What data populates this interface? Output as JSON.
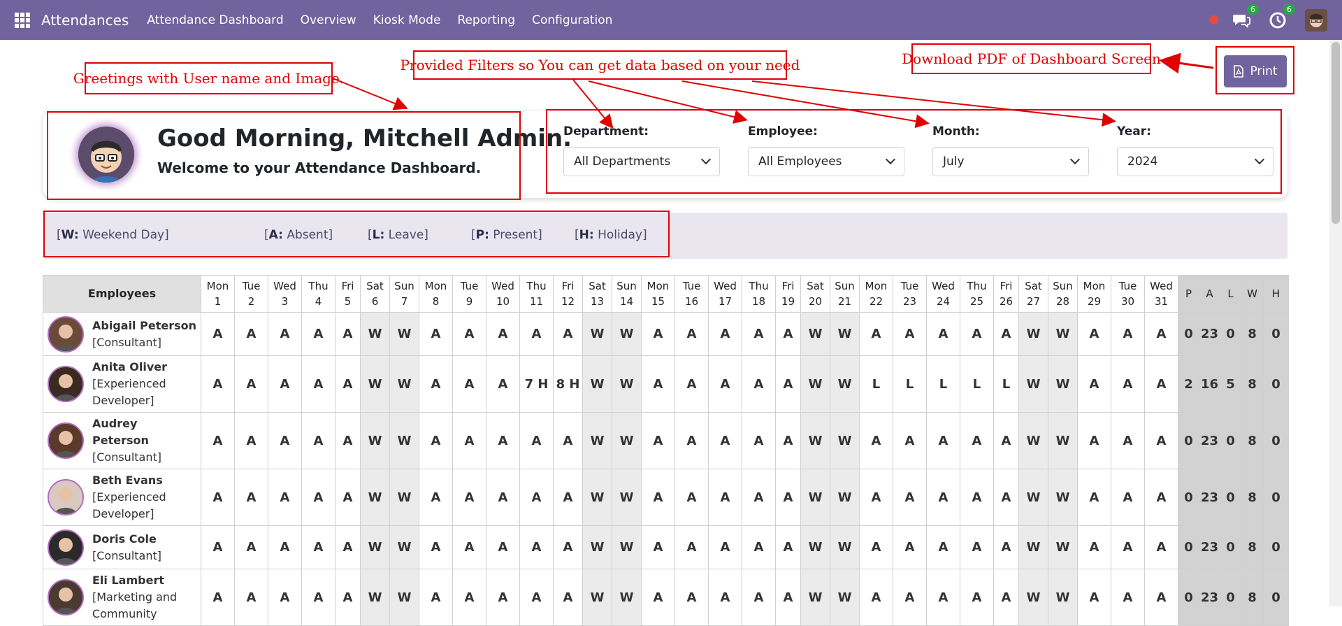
{
  "navbar": {
    "app_title": "Attendances",
    "menu": [
      "Attendance Dashboard",
      "Overview",
      "Kiosk Mode",
      "Reporting",
      "Configuration"
    ],
    "messages_badge": "6",
    "activities_badge": "6",
    "icons": [
      "apps-grid-icon",
      "record-dot-icon",
      "chat-icon",
      "clock-icon",
      "user-avatar"
    ]
  },
  "annotations": {
    "greeting_note": "Greetings with User name and Image.",
    "filters_note": "Provided Filters so You can get data based on your need",
    "pdf_note": "Download PDF of Dashboard Screen"
  },
  "print_button": {
    "label": "Print",
    "icon": "file-pdf-icon"
  },
  "greeting": {
    "title": "Good Morning, Mitchell Admin.",
    "subtitle": "Welcome to your Attendance Dashboard."
  },
  "filters": [
    {
      "label": "Department:",
      "value": "All Departments"
    },
    {
      "label": "Employee:",
      "value": "All Employees"
    },
    {
      "label": "Month:",
      "value": "July"
    },
    {
      "label": "Year:",
      "value": "2024"
    }
  ],
  "legend": [
    {
      "code": "W:",
      "text": " Weekend Day]"
    },
    {
      "code": "A:",
      "text": " Absent]"
    },
    {
      "code": "L:",
      "text": " Leave]"
    },
    {
      "code": "P:",
      "text": " Present]"
    },
    {
      "code": "H:",
      "text": " Holiday]"
    }
  ],
  "table": {
    "employee_header": "Employees",
    "days": [
      [
        "Mon",
        "1"
      ],
      [
        "Tue",
        "2"
      ],
      [
        "Wed",
        "3"
      ],
      [
        "Thu",
        "4"
      ],
      [
        "Fri",
        "5"
      ],
      [
        "Sat",
        "6"
      ],
      [
        "Sun",
        "7"
      ],
      [
        "Mon",
        "8"
      ],
      [
        "Tue",
        "9"
      ],
      [
        "Wed",
        "10"
      ],
      [
        "Thu",
        "11"
      ],
      [
        "Fri",
        "12"
      ],
      [
        "Sat",
        "13"
      ],
      [
        "Sun",
        "14"
      ],
      [
        "Mon",
        "15"
      ],
      [
        "Tue",
        "16"
      ],
      [
        "Wed",
        "17"
      ],
      [
        "Thu",
        "18"
      ],
      [
        "Fri",
        "19"
      ],
      [
        "Sat",
        "20"
      ],
      [
        "Sun",
        "21"
      ],
      [
        "Mon",
        "22"
      ],
      [
        "Tue",
        "23"
      ],
      [
        "Wed",
        "24"
      ],
      [
        "Thu",
        "25"
      ],
      [
        "Fri",
        "26"
      ],
      [
        "Sat",
        "27"
      ],
      [
        "Sun",
        "28"
      ],
      [
        "Mon",
        "29"
      ],
      [
        "Tue",
        "30"
      ],
      [
        "Wed",
        "31"
      ]
    ],
    "summary_headers": [
      "P",
      "A",
      "L",
      "W",
      "H"
    ],
    "rows": [
      {
        "name": "Abigail Peterson",
        "job": "[Consultant]",
        "marks": [
          "A",
          "A",
          "A",
          "A",
          "A",
          "W",
          "W",
          "A",
          "A",
          "A",
          "A",
          "A",
          "W",
          "W",
          "A",
          "A",
          "A",
          "A",
          "A",
          "W",
          "W",
          "A",
          "A",
          "A",
          "A",
          "A",
          "W",
          "W",
          "A",
          "A",
          "A"
        ],
        "summary": [
          "0",
          "23",
          "0",
          "8",
          "0"
        ]
      },
      {
        "name": "Anita Oliver",
        "job": "[Experienced Developer]",
        "marks": [
          "A",
          "A",
          "A",
          "A",
          "A",
          "W",
          "W",
          "A",
          "A",
          "A",
          "7 H",
          "8 H",
          "W",
          "W",
          "A",
          "A",
          "A",
          "A",
          "A",
          "W",
          "W",
          "L",
          "L",
          "L",
          "L",
          "L",
          "W",
          "W",
          "A",
          "A",
          "A"
        ],
        "summary": [
          "2",
          "16",
          "5",
          "8",
          "0"
        ]
      },
      {
        "name": "Audrey Peterson",
        "job": "[Consultant]",
        "marks": [
          "A",
          "A",
          "A",
          "A",
          "A",
          "W",
          "W",
          "A",
          "A",
          "A",
          "A",
          "A",
          "W",
          "W",
          "A",
          "A",
          "A",
          "A",
          "A",
          "W",
          "W",
          "A",
          "A",
          "A",
          "A",
          "A",
          "W",
          "W",
          "A",
          "A",
          "A"
        ],
        "summary": [
          "0",
          "23",
          "0",
          "8",
          "0"
        ]
      },
      {
        "name": "Beth Evans",
        "job": "[Experienced Developer]",
        "marks": [
          "A",
          "A",
          "A",
          "A",
          "A",
          "W",
          "W",
          "A",
          "A",
          "A",
          "A",
          "A",
          "W",
          "W",
          "A",
          "A",
          "A",
          "A",
          "A",
          "W",
          "W",
          "A",
          "A",
          "A",
          "A",
          "A",
          "W",
          "W",
          "A",
          "A",
          "A"
        ],
        "summary": [
          "0",
          "23",
          "0",
          "8",
          "0"
        ]
      },
      {
        "name": "Doris Cole",
        "job": "[Consultant]",
        "marks": [
          "A",
          "A",
          "A",
          "A",
          "A",
          "W",
          "W",
          "A",
          "A",
          "A",
          "A",
          "A",
          "W",
          "W",
          "A",
          "A",
          "A",
          "A",
          "A",
          "W",
          "W",
          "A",
          "A",
          "A",
          "A",
          "A",
          "W",
          "W",
          "A",
          "A",
          "A"
        ],
        "summary": [
          "0",
          "23",
          "0",
          "8",
          "0"
        ]
      },
      {
        "name": "Eli Lambert",
        "job": "[Marketing and Community",
        "marks": [
          "A",
          "A",
          "A",
          "A",
          "A",
          "W",
          "W",
          "A",
          "A",
          "A",
          "A",
          "A",
          "W",
          "W",
          "A",
          "A",
          "A",
          "A",
          "A",
          "W",
          "W",
          "A",
          "A",
          "A",
          "A",
          "A",
          "W",
          "W",
          "A",
          "A",
          "A"
        ],
        "summary": [
          "0",
          "23",
          "0",
          "8",
          "0"
        ]
      }
    ]
  },
  "colors": {
    "navbar": "#71639e",
    "annotation": "#e00000",
    "leave": "#e00000",
    "present_hours": "#1a8a1a",
    "weekend_bg": "#ebebeb",
    "summary_bg": "#d2d2d2",
    "legend_bg": "#e9e6f0"
  }
}
